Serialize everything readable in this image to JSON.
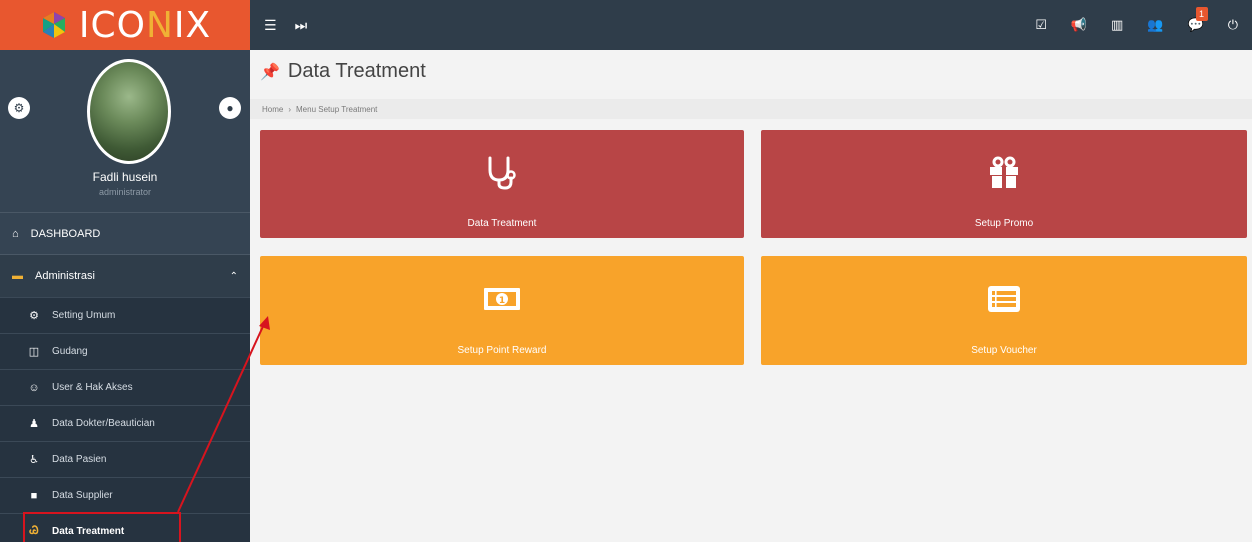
{
  "app": {
    "logo_text": "ICONIX",
    "logo_highlight": "N"
  },
  "profile": {
    "name": "Fadli husein",
    "role": "administrator"
  },
  "sidebar": {
    "dashboard": "DASHBOARD",
    "group": "Administrasi",
    "items": [
      {
        "label": "Setting Umum",
        "icon": "gear-icon"
      },
      {
        "label": "Gudang",
        "icon": "columns-icon"
      },
      {
        "label": "User & Hak Akses",
        "icon": "smile-icon"
      },
      {
        "label": "Data Dokter/Beautician",
        "icon": "user-icon"
      },
      {
        "label": "Data Pasien",
        "icon": "wheelchair-icon"
      },
      {
        "label": "Data Supplier",
        "icon": "truck-icon"
      },
      {
        "label": "Data Treatment",
        "icon": "stethoscope-icon",
        "active": true
      }
    ]
  },
  "topbar": {
    "notif_count": "1"
  },
  "page": {
    "title": "Data Treatment",
    "breadcrumb": [
      "Home",
      "Menu Setup Treatment"
    ]
  },
  "tiles": [
    {
      "label": "Data Treatment",
      "icon": "stethoscope-icon",
      "color": "#b84546"
    },
    {
      "label": "Setup Promo",
      "icon": "gift-icon",
      "color": "#b84546"
    },
    {
      "label": "Setup Point Reward",
      "icon": "money-icon",
      "color": "#f8a32a"
    },
    {
      "label": "Setup Voucher",
      "icon": "list-alt-icon",
      "color": "#f8a32a"
    }
  ],
  "colors": {
    "sidebar": "#2f3d4a",
    "logo_bg": "#e8572f",
    "annotation": "#d7141e"
  }
}
